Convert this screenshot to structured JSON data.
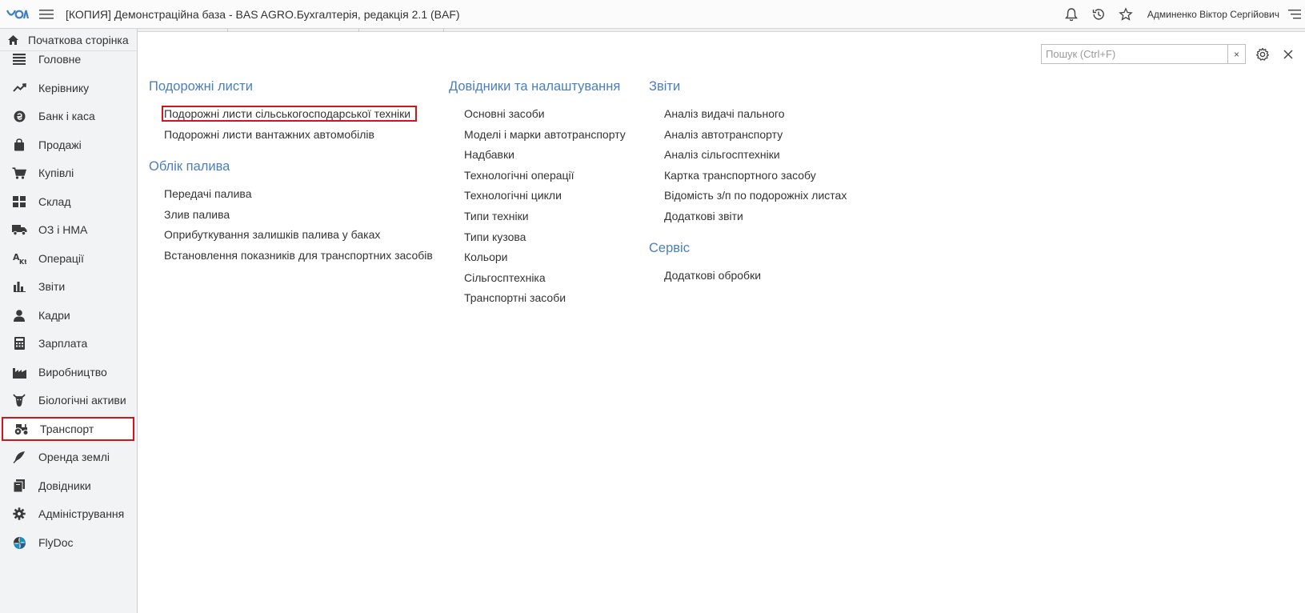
{
  "header": {
    "title": "[КОПИЯ] Демонстраційна база - BAS AGRO.Бухгалтерія, редакція 2.1  (BAF)",
    "user": "Админенко Віктор Сергійович",
    "icons": [
      "bell-icon",
      "history-icon",
      "star-icon",
      "settings-menu-icon"
    ]
  },
  "sidebar": {
    "home": "Початкова сторінка",
    "items": [
      {
        "label": "Головне",
        "icon": "list-icon"
      },
      {
        "label": "Керівнику",
        "icon": "trend-icon"
      },
      {
        "label": "Банк і каса",
        "icon": "currency-icon"
      },
      {
        "label": "Продажі",
        "icon": "bag-icon"
      },
      {
        "label": "Купівлі",
        "icon": "cart-icon"
      },
      {
        "label": "Склад",
        "icon": "warehouse-icon"
      },
      {
        "label": "ОЗ і НМА",
        "icon": "truck-icon"
      },
      {
        "label": "Операції",
        "icon": "operations-icon"
      },
      {
        "label": "Звіти",
        "icon": "bar-chart-icon"
      },
      {
        "label": "Кадри",
        "icon": "person-icon"
      },
      {
        "label": "Зарплата",
        "icon": "calculator-icon"
      },
      {
        "label": "Виробництво",
        "icon": "factory-icon"
      },
      {
        "label": "Біологічні активи",
        "icon": "cow-icon"
      },
      {
        "label": "Транспорт",
        "icon": "tractor-icon"
      },
      {
        "label": "Оренда землі",
        "icon": "feather-icon"
      },
      {
        "label": "Довідники",
        "icon": "books-icon"
      },
      {
        "label": "Адміністрування",
        "icon": "gear-icon"
      },
      {
        "label": "FlyDoc",
        "icon": "flydoc-icon"
      }
    ],
    "active_index": 13
  },
  "search": {
    "placeholder": "Пошук (Ctrl+F)",
    "clear": "×"
  },
  "columns": [
    {
      "sections": [
        {
          "title": "Подорожні листи",
          "links": [
            "Подорожні листи сільськогосподарської техніки",
            "Подорожні листи вантажних автомобілів"
          ]
        },
        {
          "title": "Облік палива",
          "links": [
            "Передачі палива",
            "Злив палива",
            "Оприбуткування залишків палива у баках",
            "Встановлення показників для транспортних засобів"
          ]
        }
      ]
    },
    {
      "sections": [
        {
          "title": "Довідники та налаштування",
          "links": [
            "Основні засоби",
            "Моделі і марки автотранспорту",
            "Надбавки",
            "Технологічні операції",
            "Технологічні цикли",
            "Типи техніки",
            "Типи кузова",
            "Кольори",
            "Сільгосптехніка",
            "Транспортні засоби"
          ]
        }
      ]
    },
    {
      "sections": [
        {
          "title": "Звіти",
          "links": [
            "Аналіз видачі пального",
            "Аналіз автотранспорту",
            "Аналіз сільгосптехніки",
            "Картка транспортного засобу",
            "Відомість з/п по подорожніх листах",
            "Додаткові звіти"
          ]
        },
        {
          "title": "Сервіс",
          "links": [
            "Додаткові обробки"
          ]
        }
      ]
    }
  ],
  "colors": {
    "accent": "#4a7fbf",
    "highlight": "#d2151c",
    "logo": "#3d7fc4"
  }
}
